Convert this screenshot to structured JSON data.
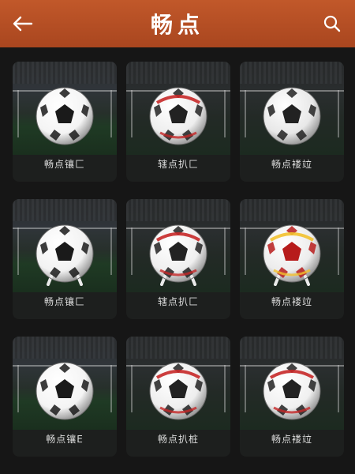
{
  "header": {
    "title": "畅点",
    "back_icon": "arrow-left-icon",
    "search_icon": "search-icon",
    "bg_color": "#b14d22"
  },
  "cards": [
    {
      "label": "畅点镶匚",
      "ball": "classic",
      "scene": "normal"
    },
    {
      "label": "辖点扒匚",
      "ball": "red-stripe",
      "scene": "dim"
    },
    {
      "label": "畅点褛竝",
      "ball": "classic-dark",
      "scene": "dim"
    },
    {
      "label": "畅点镶匚",
      "ball": "player-classic",
      "scene": "normal"
    },
    {
      "label": "辖点扒匚",
      "ball": "player-red",
      "scene": "dim"
    },
    {
      "label": "畅点褛竝",
      "ball": "player-yellow",
      "scene": "dim"
    },
    {
      "label": "畅点镶E",
      "ball": "classic",
      "scene": "normal"
    },
    {
      "label": "畅点扒桩",
      "ball": "red-stripe",
      "scene": "dim"
    },
    {
      "label": "畅点褛竝",
      "ball": "red-yellow",
      "scene": "dim"
    }
  ]
}
